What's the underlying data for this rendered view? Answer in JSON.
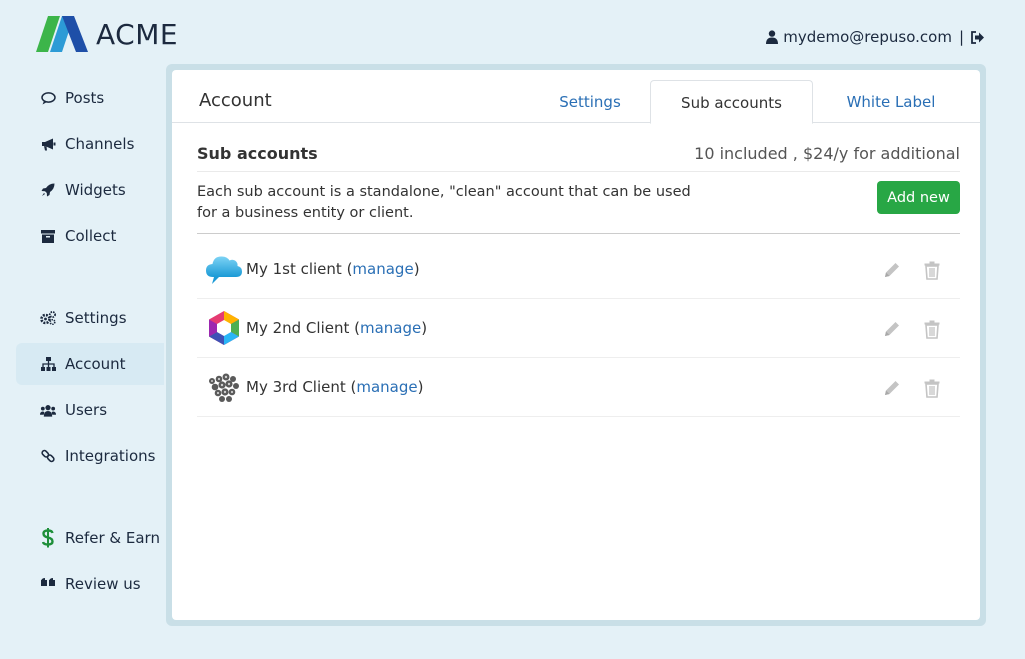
{
  "app": {
    "brand": "ACME",
    "user_email": "mydemo@repuso.com",
    "separator": "|"
  },
  "sidebar": {
    "items": [
      {
        "label": "Posts",
        "icon": "comment-icon"
      },
      {
        "label": "Channels",
        "icon": "megaphone-icon"
      },
      {
        "label": "Widgets",
        "icon": "rocket-icon"
      },
      {
        "label": "Collect",
        "icon": "archive-icon"
      },
      {
        "label": "Settings",
        "icon": "gears-icon"
      },
      {
        "label": "Account",
        "icon": "sitemap-icon",
        "active": true
      },
      {
        "label": "Users",
        "icon": "users-icon"
      },
      {
        "label": "Integrations",
        "icon": "link-icon"
      },
      {
        "label": "Refer & Earn",
        "icon": "dollar-icon"
      },
      {
        "label": "Review us",
        "icon": "quote-icon"
      }
    ]
  },
  "card": {
    "title": "Account",
    "tabs": [
      {
        "label": "Settings"
      },
      {
        "label": "Sub accounts",
        "active": true
      },
      {
        "label": "White Label"
      }
    ]
  },
  "sub_accounts": {
    "title": "Sub accounts",
    "meta": "10 included , $24/y for additional",
    "description": "Each sub account is a standalone, \"clean\" account that can be used for a business entity or client.",
    "add_button": "Add new",
    "manage_label": "manage",
    "clients": [
      {
        "name": "My 1st client",
        "logo": "cloud-logo"
      },
      {
        "name": "My 2nd Client",
        "logo": "hexagon-logo"
      },
      {
        "name": "My 3rd Client",
        "logo": "dots-logo"
      }
    ]
  },
  "colors": {
    "background": "#e4f1f7",
    "accent_link": "#2a6fb5",
    "add_button": "#28a745",
    "nav_text": "#1c2a3f",
    "refer_dollar": "#1e8f3a"
  }
}
